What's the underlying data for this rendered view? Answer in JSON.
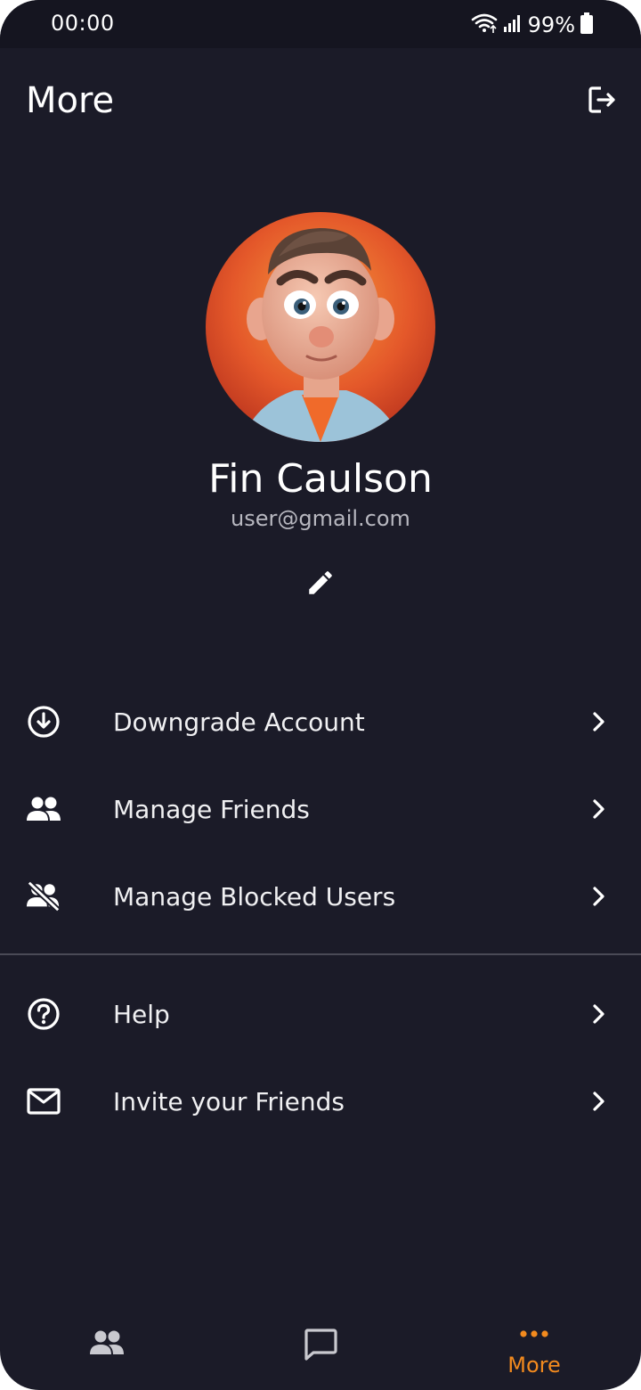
{
  "status_bar": {
    "time": "00:00",
    "battery": "99%",
    "icons": [
      "wifi-icon",
      "signal-icon",
      "battery-icon"
    ]
  },
  "header": {
    "title": "More",
    "logout_icon": "logout-icon"
  },
  "profile": {
    "name": "Fin Caulson",
    "email": "user@gmail.com",
    "edit_icon": "pencil-icon"
  },
  "menu": {
    "primary": [
      {
        "icon": "download-circle-icon",
        "label": "Downgrade Account"
      },
      {
        "icon": "people-icon",
        "label": "Manage Friends"
      },
      {
        "icon": "people-blocked-icon",
        "label": "Manage Blocked Users"
      }
    ],
    "secondary": [
      {
        "icon": "help-circle-icon",
        "label": "Help"
      },
      {
        "icon": "mail-icon",
        "label": "Invite your Friends"
      }
    ]
  },
  "bottom_nav": {
    "items": [
      {
        "icon": "people-icon",
        "label": "",
        "active": false
      },
      {
        "icon": "chat-icon",
        "label": "",
        "active": false
      },
      {
        "icon": "more-dots-icon",
        "label": "More",
        "active": true
      }
    ]
  },
  "colors": {
    "background": "#1b1b28",
    "status_bar": "#151520",
    "accent": "#f28a1e",
    "text_primary": "#ffffff",
    "text_secondary": "#b8b8c0",
    "divider": "#4a4a56",
    "nav_inactive": "#c9c9cf"
  }
}
